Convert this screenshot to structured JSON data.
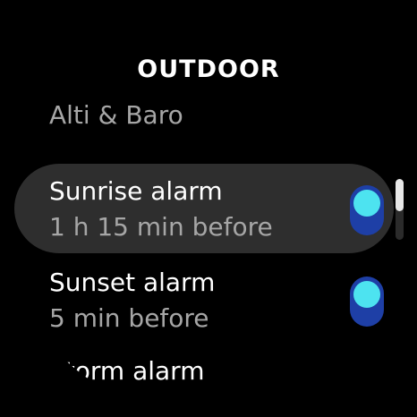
{
  "header": {
    "title": "OUTDOOR"
  },
  "section": {
    "label": "Alti & Baro"
  },
  "alarms": [
    {
      "title": "Sunrise alarm",
      "subtitle": "1 h 15 min before",
      "enabled": true,
      "highlighted": true
    },
    {
      "title": "Sunset alarm",
      "subtitle": "5 min before",
      "enabled": true,
      "highlighted": false
    },
    {
      "title": "Storm alarm"
    }
  ],
  "colors": {
    "background": "#000000",
    "highlight_row": "#2e2e2e",
    "toggle_track": "#1e3fa6",
    "toggle_knob": "#4de3f0",
    "primary_text": "#ffffff",
    "secondary_text": "#a6a6a6"
  },
  "scroll": {
    "position_fraction": 0.0
  }
}
